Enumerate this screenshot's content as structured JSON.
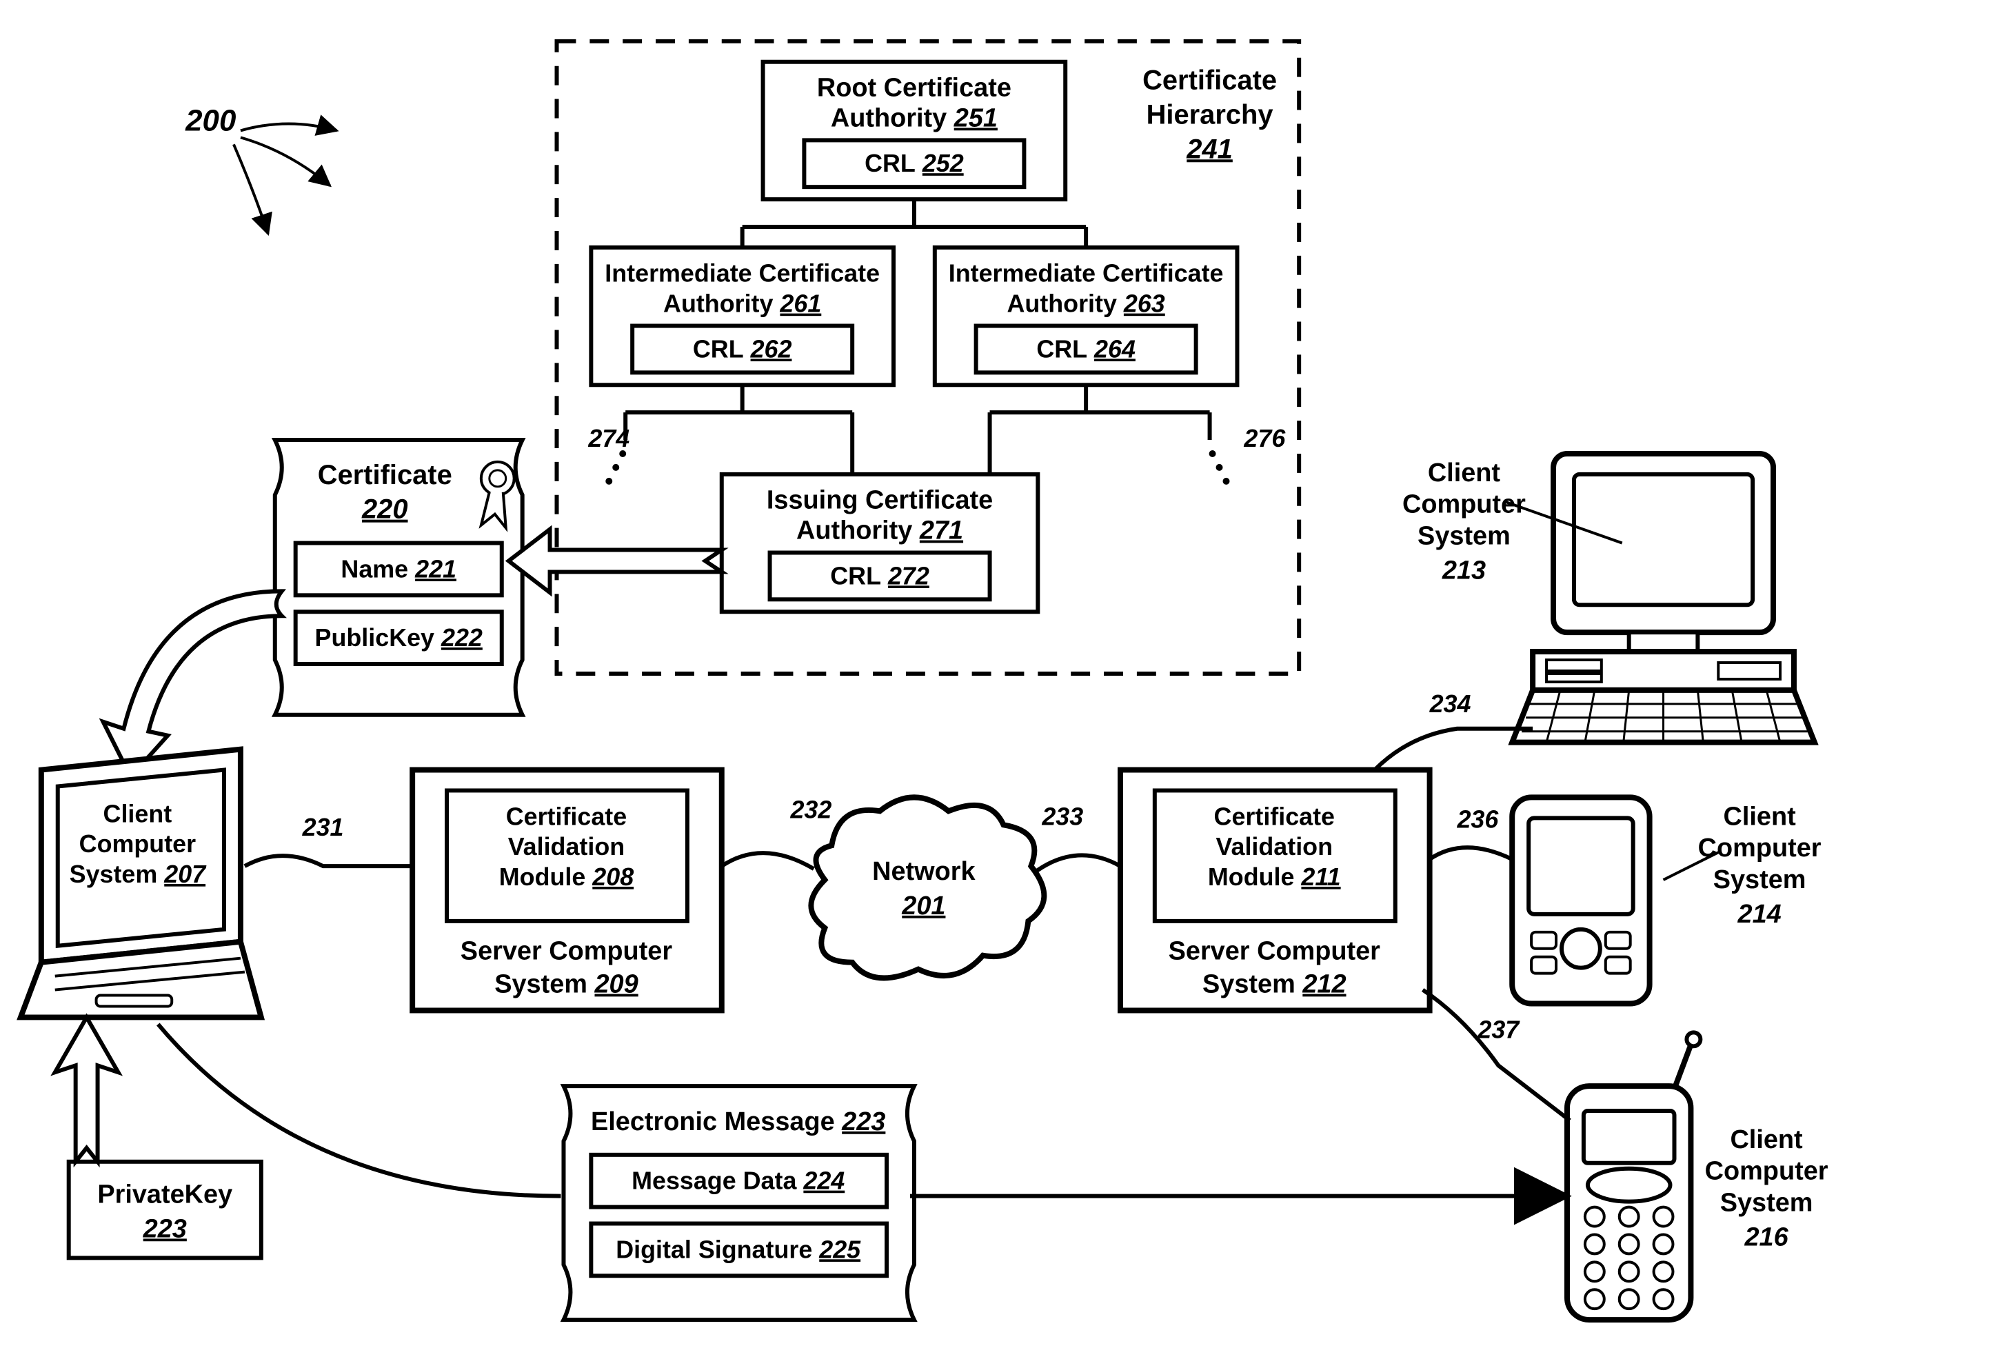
{
  "fig_ref": {
    "label": "200"
  },
  "hierarchy": {
    "title": "Certificate Hierarchy",
    "ref": "241",
    "root": {
      "label": "Root Certificate Authority",
      "ref": "251",
      "crl_label": "CRL",
      "crl_ref": "252"
    },
    "int_l": {
      "label": "Intermediate Certificate Authority",
      "ref": "261",
      "crl_label": "CRL",
      "crl_ref": "262"
    },
    "int_r": {
      "label": "Intermediate Certificate Authority",
      "ref": "263",
      "crl_label": "CRL",
      "crl_ref": "264"
    },
    "issuer": {
      "label": "Issuing Certificate Authority",
      "ref": "271",
      "crl_label": "CRL",
      "crl_ref": "272"
    },
    "dots_l_ref": "274",
    "dots_r_ref": "276"
  },
  "cert": {
    "title": "Certificate",
    "ref": "220",
    "name_label": "Name",
    "name_ref": "221",
    "pk_label": "PublicKey",
    "pk_ref": "222"
  },
  "privkey": {
    "label": "PrivateKey",
    "ref": "223"
  },
  "laptop": {
    "line1": "Client",
    "line2": "Computer",
    "line3": "System",
    "ref": "207"
  },
  "server_l": {
    "sys_label": "Server Computer System",
    "sys_ref": "209",
    "mod_label": "Certificate Validation Module",
    "mod_ref": "208"
  },
  "server_r": {
    "sys_label": "Server Computer System",
    "sys_ref": "212",
    "mod_label": "Certificate Validation Module",
    "mod_ref": "211"
  },
  "network": {
    "label": "Network",
    "ref": "201"
  },
  "msg": {
    "title": "Electronic Message",
    "ref": "223",
    "data_label": "Message Data",
    "data_ref": "224",
    "sig_label": "Digital Signature",
    "sig_ref": "225"
  },
  "clients": {
    "desktop": {
      "line1": "Client",
      "line2": "Computer",
      "line3": "System",
      "ref": "213"
    },
    "pda": {
      "line1": "Client",
      "line2": "Computer",
      "line3": "System",
      "ref": "214"
    },
    "phone": {
      "line1": "Client",
      "line2": "Computer",
      "line3": "System",
      "ref": "216"
    }
  },
  "links": {
    "r231": "231",
    "r232": "232",
    "r233": "233",
    "r234": "234",
    "r236": "236",
    "r237": "237"
  }
}
